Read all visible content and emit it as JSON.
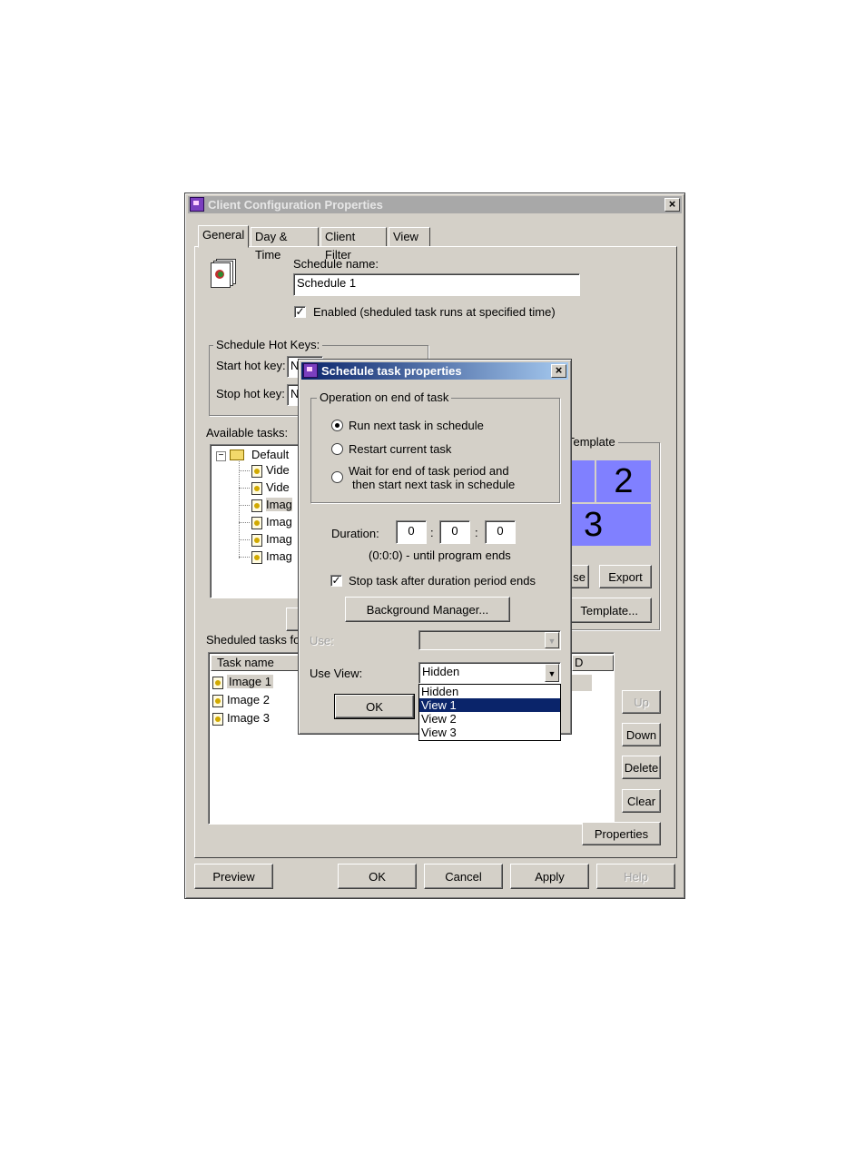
{
  "main_window": {
    "title": "Client Configuration Properties",
    "tabs": [
      "General",
      "Day & Time",
      "Client Filter",
      "View"
    ],
    "schedule_name_label": "Schedule name:",
    "schedule_name_value": "Schedule 1",
    "enabled_label": "Enabled (sheduled task runs at specified time)",
    "enabled_checked": true,
    "hotkeys_group": "Schedule Hot Keys:",
    "start_hotkey_label": "Start hot key:",
    "start_hotkey_value": "N",
    "stop_hotkey_label": "Stop hot key:",
    "stop_hotkey_value": "N",
    "available_tasks_label": "Available tasks:",
    "tree": {
      "root": "Default",
      "items": [
        "Vide",
        "Vide",
        "Imag",
        "Imag",
        "Imag",
        "Imag"
      ]
    },
    "template_group": "Template",
    "template_cells": [
      "2",
      "3"
    ],
    "template_buttons": {
      "browse": "se",
      "export": "Export",
      "new_template": "Template..."
    },
    "scheduled_tasks_label": "Sheduled tasks fo",
    "scheduled_table": {
      "col_task_name": "Task name",
      "col_id": "D",
      "rows": [
        "Image 1",
        "Image 2",
        "Image 3"
      ]
    },
    "side_buttons": {
      "up": "Up",
      "down": "Down",
      "delete": "Delete",
      "clear": "Clear"
    },
    "properties_button": "Properties",
    "bottom_buttons": {
      "preview": "Preview",
      "ok": "OK",
      "cancel": "Cancel",
      "apply": "Apply",
      "help": "Help"
    }
  },
  "dialog": {
    "title": "Schedule task properties",
    "operation_group": "Operation on end of task",
    "radio_run_next": "Run next task in schedule",
    "radio_restart": "Restart current task",
    "radio_wait_line1": "Wait for end of task period and",
    "radio_wait_line2": "then start next task in schedule",
    "selected_radio": "run_next",
    "duration_label": "Duration:",
    "duration_h": "0",
    "duration_m": "0",
    "duration_s": "0",
    "separator": ":",
    "duration_hint": "(0:0:0) - until program ends",
    "stop_after_label": "Stop task after duration period ends",
    "stop_after_checked": true,
    "background_manager_button": "Background Manager...",
    "use_label": "Use:",
    "use_value": "",
    "use_view_label": "Use View:",
    "use_view_value": "Hidden",
    "use_view_options": [
      "Hidden",
      "View 1",
      "View 2",
      "View 3"
    ],
    "use_view_highlighted": "View 1",
    "ok_button": "OK"
  },
  "colors": {
    "window_bg": "#d4d0c8",
    "active_title": "#0a246a",
    "template_cell": "#8080ff",
    "selection": "#0a246a"
  }
}
